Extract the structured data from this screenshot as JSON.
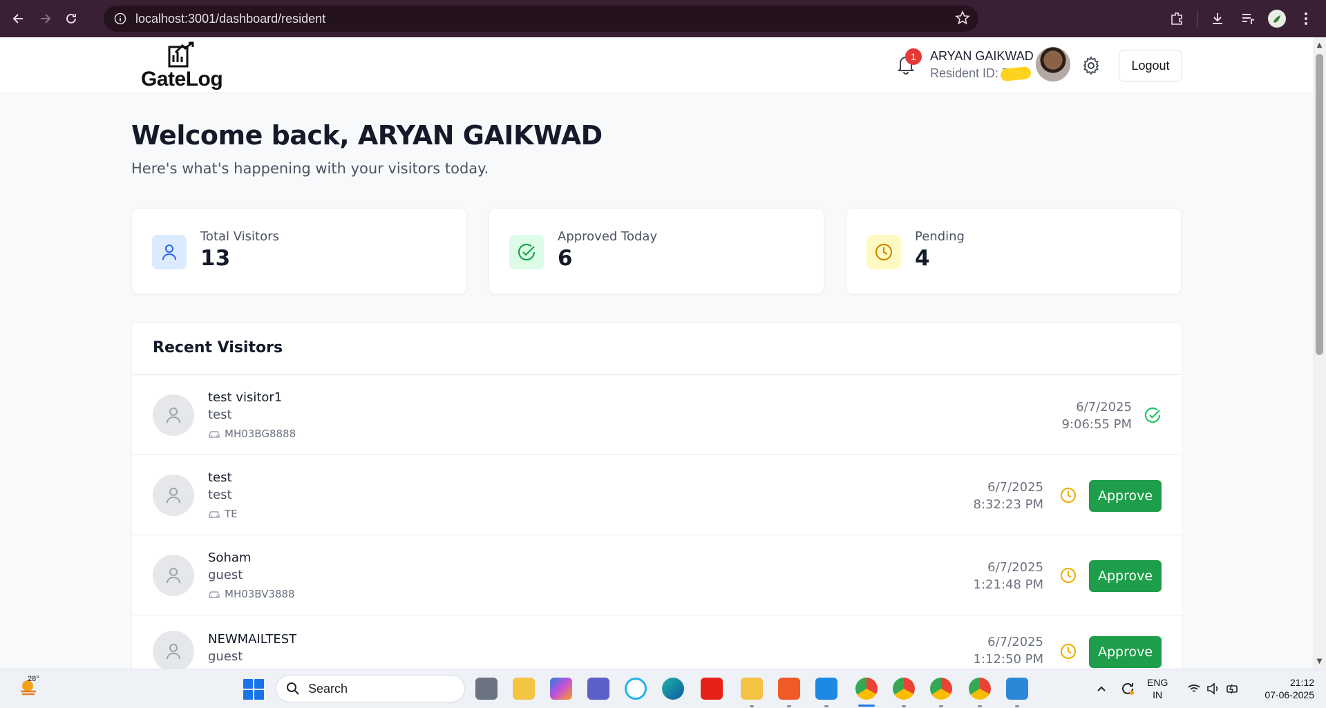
{
  "browser": {
    "url": "localhost:3001/dashboard/resident"
  },
  "header": {
    "logo_text": "GateLog",
    "notification_count": "1",
    "user_name": "ARYAN GAIKWAD",
    "resident_id_label": "Resident ID: 7",
    "logout_label": "Logout"
  },
  "welcome": {
    "title": "Welcome back, ARYAN GAIKWAD",
    "subtitle": "Here's what's happening with your visitors today."
  },
  "stats": [
    {
      "label": "Total Visitors",
      "value": "13",
      "icon": "user-icon",
      "color": "#2563eb",
      "bg": "#dbeafe"
    },
    {
      "label": "Approved Today",
      "value": "6",
      "icon": "check-circle-icon",
      "color": "#16a34a",
      "bg": "#dcfce7"
    },
    {
      "label": "Pending",
      "value": "4",
      "icon": "clock-icon",
      "color": "#ca8a04",
      "bg": "#fef9c3"
    }
  ],
  "recent": {
    "title": "Recent Visitors",
    "approve_label": "Approve",
    "rows": [
      {
        "name": "test visitor1",
        "purpose": "test",
        "vehicle": "MH03BG8888",
        "date": "6/7/2025",
        "time": "9:06:55 PM",
        "status": "approved"
      },
      {
        "name": "test",
        "purpose": "test",
        "vehicle": "TE",
        "date": "6/7/2025",
        "time": "8:32:23 PM",
        "status": "pending"
      },
      {
        "name": "Soham",
        "purpose": "guest",
        "vehicle": "MH03BV3888",
        "date": "6/7/2025",
        "time": "1:21:48 PM",
        "status": "pending"
      },
      {
        "name": "NEWMAILTEST",
        "purpose": "guest",
        "vehicle": "",
        "date": "6/7/2025",
        "time": "1:12:50 PM",
        "status": "pending"
      }
    ]
  },
  "colors": {
    "approve_green": "#1e9e4a",
    "pending_amber": "#eab308",
    "approved_green": "#22c55e",
    "browser_frame": "#3a2035"
  },
  "taskbar": {
    "temperature": "28°",
    "search_label": "Search",
    "lang_top": "ENG",
    "lang_bottom": "IN",
    "time": "21:12",
    "date": "07-06-2025"
  }
}
